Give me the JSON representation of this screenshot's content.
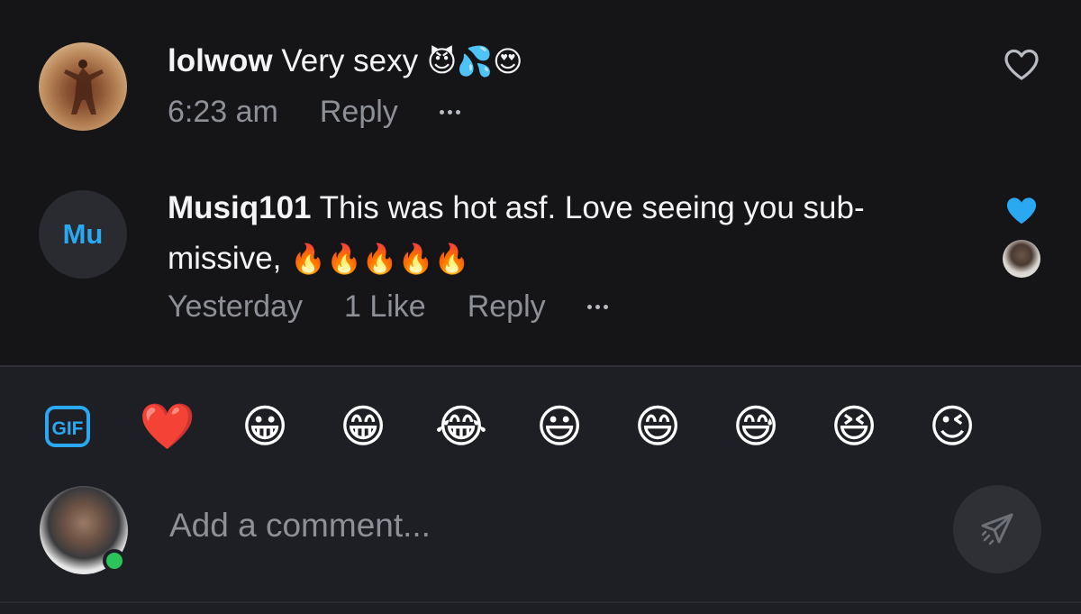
{
  "comments": [
    {
      "username": "lolwow",
      "text": "Very sexy",
      "emojis": "😈💦😍",
      "time": "6:23 am",
      "reply_label": "Reply",
      "more_label": "more options",
      "liked": false,
      "avatar": "photo-avatar"
    },
    {
      "username": "Musiq101",
      "avatar_initials": "Mu",
      "text": "This was hot asf. Love seeing you sub-",
      "text_line2": "missive,",
      "emojis": "🔥🔥🔥🔥🔥",
      "time": "Yesterday",
      "likes_label": "1 Like",
      "reply_label": "Reply",
      "liked": true,
      "liked_by_avatar": "creator-avatar"
    }
  ],
  "quick_reactions": {
    "gif_label": "GIF",
    "emojis": [
      "❤️",
      "😀",
      "😁",
      "😂",
      "😃",
      "😄",
      "😅",
      "😆",
      "😉"
    ]
  },
  "composer": {
    "placeholder": "Add a comment...",
    "send_icon": "send-icon"
  },
  "colors": {
    "background": "#151518",
    "composer_bg": "#1e1f24",
    "accent_blue": "#2aa8f2",
    "muted_text": "#8e9097",
    "online_green": "#2bc35a"
  }
}
